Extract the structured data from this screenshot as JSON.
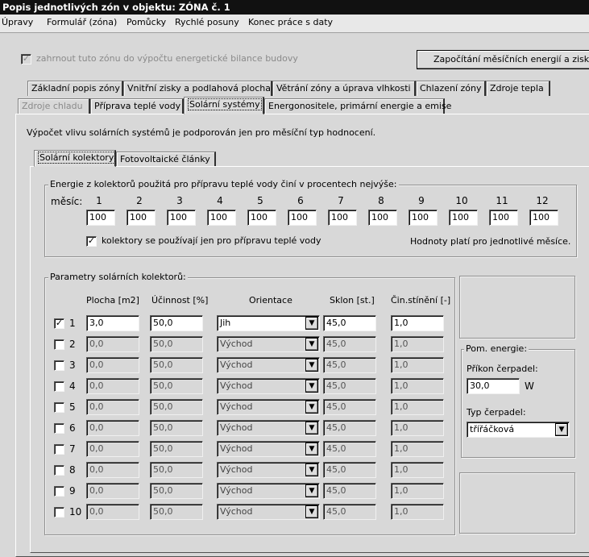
{
  "window": {
    "title": "Popis jednotlivých zón v objektu:   ZÓNA č. 1"
  },
  "menu": [
    "Úpravy",
    "Formulář (zóna)",
    "Pomůcky",
    "Rychlé posuny",
    "Konec práce s daty"
  ],
  "top": {
    "include_checkbox_label": "zahrnout tuto zónu do výpočtu energetické bilance budovy",
    "include_checked": true,
    "calc_button_label": "Započítání měsíčních energií a zisků"
  },
  "tabs_row1": [
    "Základní popis zóny",
    "Vnitřní zisky a podlahová plocha",
    "Větrání zóny a úprava vlhkosti",
    "Chlazení zóny",
    "Zdroje tepla"
  ],
  "tabs_row2": [
    "Zdroje chladu",
    "Příprava teplé vody",
    "Solární systémy",
    "Energonositele, primární energie a emise"
  ],
  "info_text": "Výpočet vlivu solárních systémů je podporován jen pro měsíční typ hodnocení.",
  "subtabs": [
    "Solární kolektory",
    "Fotovoltaické články"
  ],
  "energy_group": {
    "title": "Energie z kolektorů použitá pro přípravu teplé vody činí v procentech nejvýše:",
    "month_label": "měsíc:",
    "months": [
      "1",
      "2",
      "3",
      "4",
      "5",
      "6",
      "7",
      "8",
      "9",
      "10",
      "11",
      "12"
    ],
    "values": [
      "100",
      "100",
      "100",
      "100",
      "100",
      "100",
      "100",
      "100",
      "100",
      "100",
      "100",
      "100"
    ],
    "dhw_only_label": "kolektory se používají jen pro přípravu teplé vody",
    "dhw_only_checked": true,
    "note": "Hodnoty platí pro jednotlivé měsíce."
  },
  "params_group": {
    "title": "Parametry solárních kolektorů:",
    "headers": [
      "Plocha [m2]",
      "Účinnost [%]",
      "Orientace",
      "Sklon [st.]",
      "Čin.stínění [-]"
    ],
    "rows": [
      {
        "n": "1",
        "checked": true,
        "area": "3,0",
        "eff": "50,0",
        "orient": "Jih",
        "tilt": "45,0",
        "shade": "1,0"
      },
      {
        "n": "2",
        "checked": false,
        "area": "0,0",
        "eff": "50,0",
        "orient": "Východ",
        "tilt": "45,0",
        "shade": "1,0"
      },
      {
        "n": "3",
        "checked": false,
        "area": "0,0",
        "eff": "50,0",
        "orient": "Východ",
        "tilt": "45,0",
        "shade": "1,0"
      },
      {
        "n": "4",
        "checked": false,
        "area": "0,0",
        "eff": "50,0",
        "orient": "Východ",
        "tilt": "45,0",
        "shade": "1,0"
      },
      {
        "n": "5",
        "checked": false,
        "area": "0,0",
        "eff": "50,0",
        "orient": "Východ",
        "tilt": "45,0",
        "shade": "1,0"
      },
      {
        "n": "6",
        "checked": false,
        "area": "0,0",
        "eff": "50,0",
        "orient": "Východ",
        "tilt": "45,0",
        "shade": "1,0"
      },
      {
        "n": "7",
        "checked": false,
        "area": "0,0",
        "eff": "50,0",
        "orient": "Východ",
        "tilt": "45,0",
        "shade": "1,0"
      },
      {
        "n": "8",
        "checked": false,
        "area": "0,0",
        "eff": "50,0",
        "orient": "Východ",
        "tilt": "45,0",
        "shade": "1,0"
      },
      {
        "n": "9",
        "checked": false,
        "area": "0,0",
        "eff": "50,0",
        "orient": "Východ",
        "tilt": "45,0",
        "shade": "1,0"
      },
      {
        "n": "10",
        "checked": false,
        "area": "0,0",
        "eff": "50,0",
        "orient": "Východ",
        "tilt": "45,0",
        "shade": "1,0"
      }
    ]
  },
  "aux_group": {
    "title": "Pom. energie:",
    "pump_power_label": "Příkon čerpadel:",
    "pump_power_value": "30,0",
    "pump_power_unit": "W",
    "pump_type_label": "Typ čerpadel:",
    "pump_type_value": "třířáčková"
  }
}
